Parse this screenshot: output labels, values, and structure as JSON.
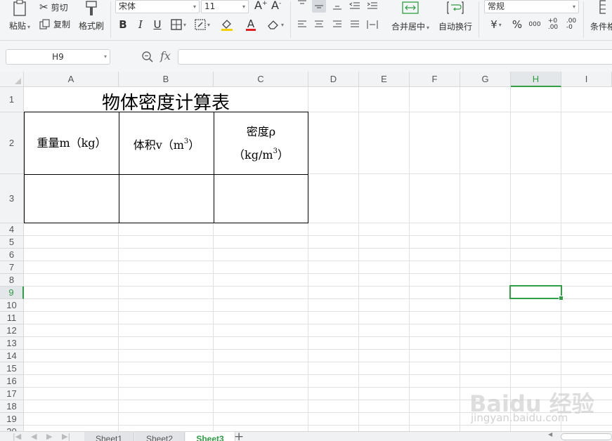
{
  "ribbon": {
    "clipboard": {
      "paste": "粘贴",
      "cut": "剪切",
      "copy": "复制",
      "format_painter": "格式刷"
    },
    "font": {
      "name": "宋体",
      "size": "11",
      "bold": "B",
      "italic": "I",
      "underline": "U",
      "font_color_letter": "A"
    },
    "alignment": {
      "merge_center": "合并居中",
      "wrap_text": "自动换行"
    },
    "number": {
      "format": "常规",
      "currency": "¥",
      "percent": "%",
      "thousands": "000"
    },
    "conditional": "条件格"
  },
  "formula_bar": {
    "name_box": "H9",
    "fx": "fx",
    "content": ""
  },
  "columns": [
    "A",
    "B",
    "C",
    "D",
    "E",
    "F",
    "G",
    "H",
    "I"
  ],
  "rows": [
    "1",
    "2",
    "3",
    "4",
    "5",
    "6",
    "7",
    "8",
    "9",
    "10",
    "11",
    "12",
    "13",
    "14",
    "15",
    "16",
    "17",
    "18",
    "19",
    "20"
  ],
  "selected_cell": "H9",
  "table": {
    "title": "物体密度计算表",
    "headers": {
      "weight": "重量m（kg）",
      "volume_prefix": "体积v（m",
      "volume_exp": "3",
      "volume_suffix": "）",
      "density_line1": "密度ρ",
      "density_prefix": "（kg/m",
      "density_exp": "3",
      "density_suffix": "）"
    }
  },
  "sheets": [
    "Sheet1",
    "Sheet2",
    "Sheet3"
  ],
  "active_sheet": "Sheet3",
  "watermark": {
    "logo": "Baidu 经验",
    "url": "jingyan.baidu.com"
  },
  "colors": {
    "accent": "#2f9e44",
    "ribbon_bg": "#f4f5f7",
    "header_bg": "#f2f3f5",
    "font_color_bar": "#e02020"
  }
}
